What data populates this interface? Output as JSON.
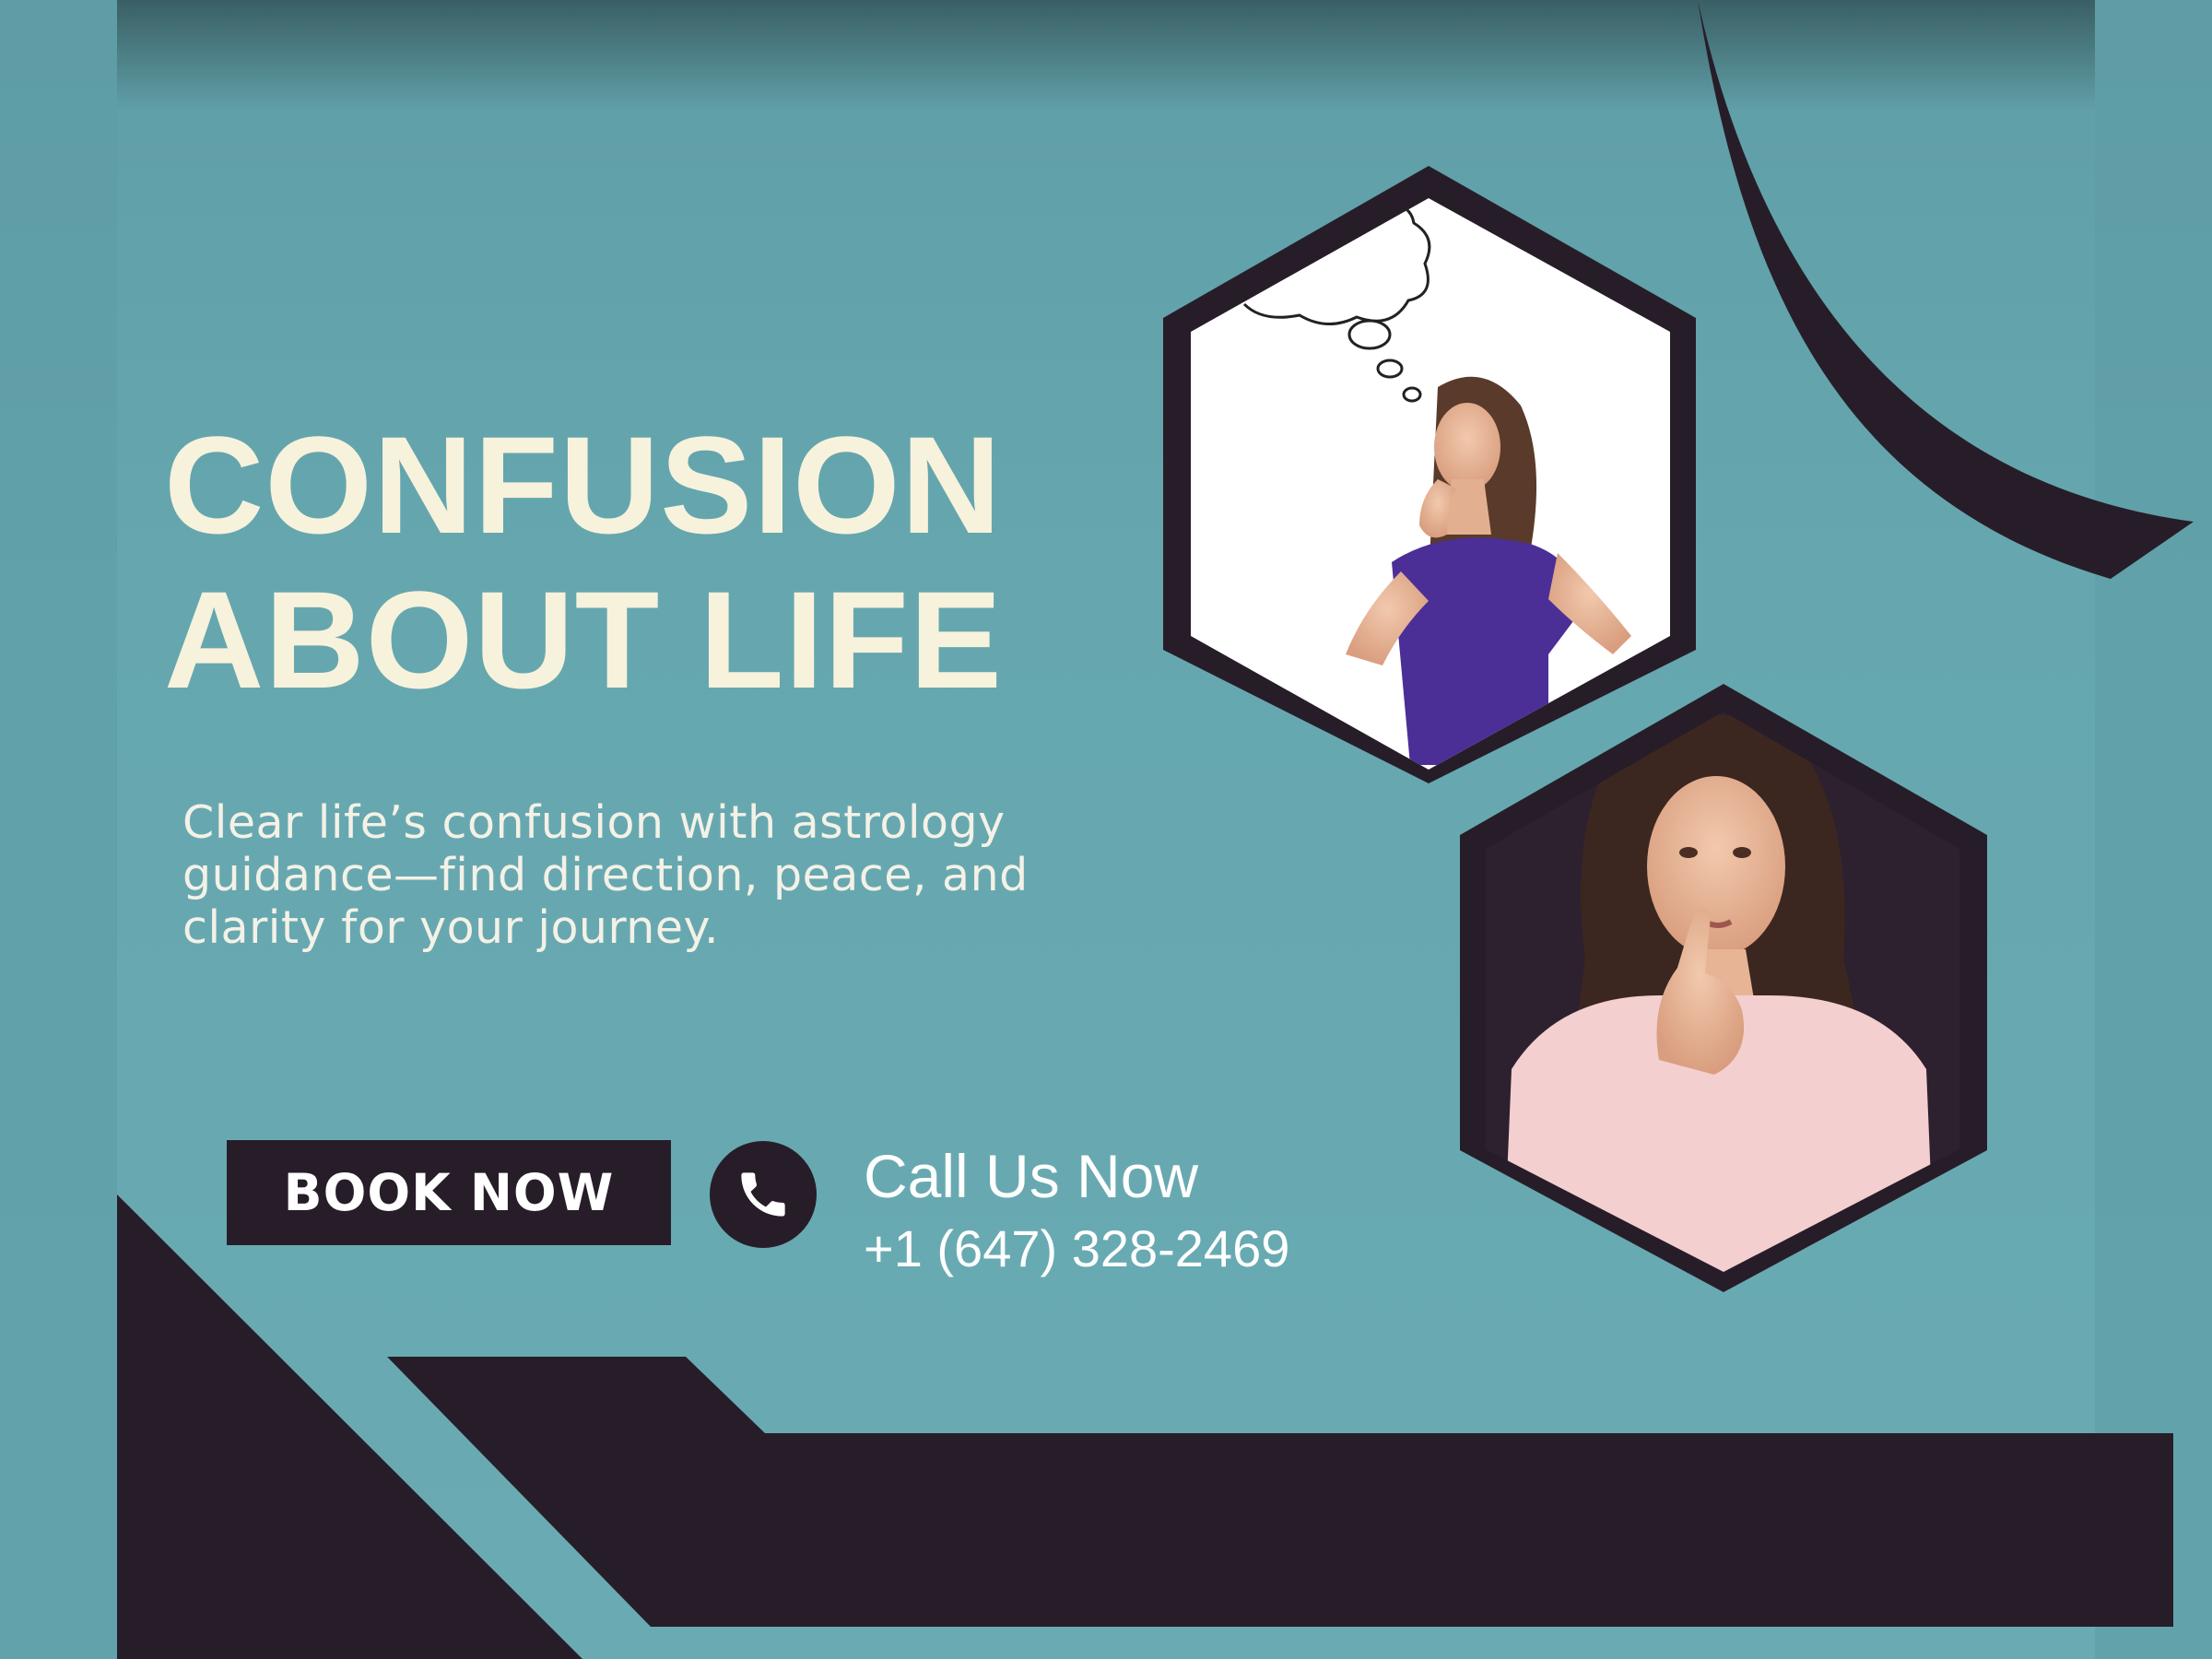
{
  "colors": {
    "background": "#68a9b1",
    "dark_accent": "#271d29",
    "headline": "#f7f2dc",
    "text": "#ffffff"
  },
  "headline": {
    "line1": "CONFUSION",
    "line2": "ABOUT LIFE"
  },
  "subtitle": {
    "line1": "Clear life’s confusion with astrology",
    "line2": "guidance—find direction, peace, and",
    "line3": "clarity for your journey."
  },
  "cta": {
    "book_label": "BOOK NOW",
    "call_label": "Call Us Now",
    "phone_number": "+1 (647) 328-2469",
    "phone_icon": "phone-icon"
  },
  "images": {
    "top": "woman-thinking-with-thought-bubble",
    "bottom": "woman-finger-on-lips-looking-up"
  }
}
